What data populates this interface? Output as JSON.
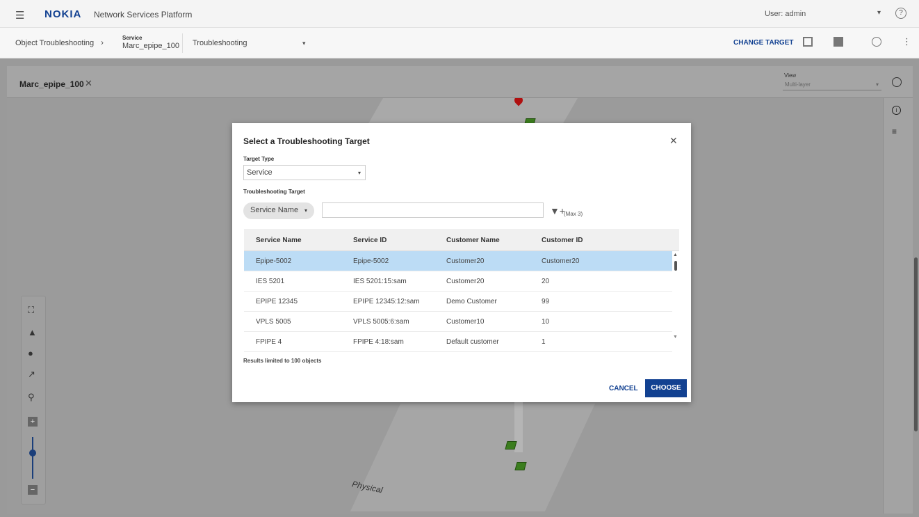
{
  "topbar": {
    "logo": "NOKIA",
    "app_name": "Network Services Platform",
    "user": "User: admin"
  },
  "breadcrumb": {
    "root": "Object Troubleshooting",
    "object_type": "Service",
    "object_name": "Marc_epipe_100",
    "mode": "Troubleshooting",
    "change_target": "CHANGE TARGET"
  },
  "panel": {
    "title": "Marc_epipe_100",
    "view_label": "View",
    "view_value": "Multi-layer",
    "layer_label": "Physical"
  },
  "modal": {
    "title": "Select a Troubleshooting Target",
    "target_type_label": "Target Type",
    "target_type_value": "Service",
    "troubleshooting_target_label": "Troubleshooting Target",
    "search_field_selector": "Service Name",
    "search_value": "",
    "max_label": "(Max 3)",
    "columns": [
      "Service Name",
      "Service ID",
      "Customer Name",
      "Customer ID"
    ],
    "rows": [
      [
        "Epipe-5002",
        "Epipe-5002",
        "Customer20",
        "Customer20"
      ],
      [
        "IES 5201",
        "IES 5201:15:sam",
        "Customer20",
        "20"
      ],
      [
        "EPIPE 12345",
        "EPIPE 12345:12:sam",
        "Demo Customer",
        "99"
      ],
      [
        "VPLS 5005",
        "VPLS 5005:6:sam",
        "Customer10",
        "10"
      ],
      [
        "FPIPE 4",
        "FPIPE 4:18:sam",
        "Default customer",
        "1"
      ]
    ],
    "selected_row": 0,
    "results_note": "Results limited to 100 objects",
    "cancel_label": "CANCEL",
    "choose_label": "CHOOSE"
  },
  "colors": {
    "brand": "#124191",
    "selected_row": "#bcdcf5"
  }
}
